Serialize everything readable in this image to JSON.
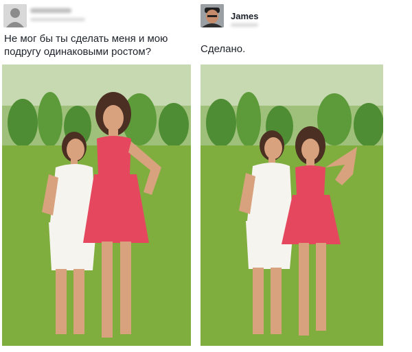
{
  "left_post": {
    "author_name": "",
    "text": "Не мог бы ты сделать меня и мою подругу одинаковыми ростом?"
  },
  "right_post": {
    "author_name": "James",
    "text": "Сделано."
  },
  "colors": {
    "grass": "#7fae3f",
    "bushes": "#4f8d34",
    "white_dress": "#f6f4ef",
    "pink_dress": "#e5475f",
    "skin": "#d9a27f",
    "hair": "#4a2f22"
  }
}
